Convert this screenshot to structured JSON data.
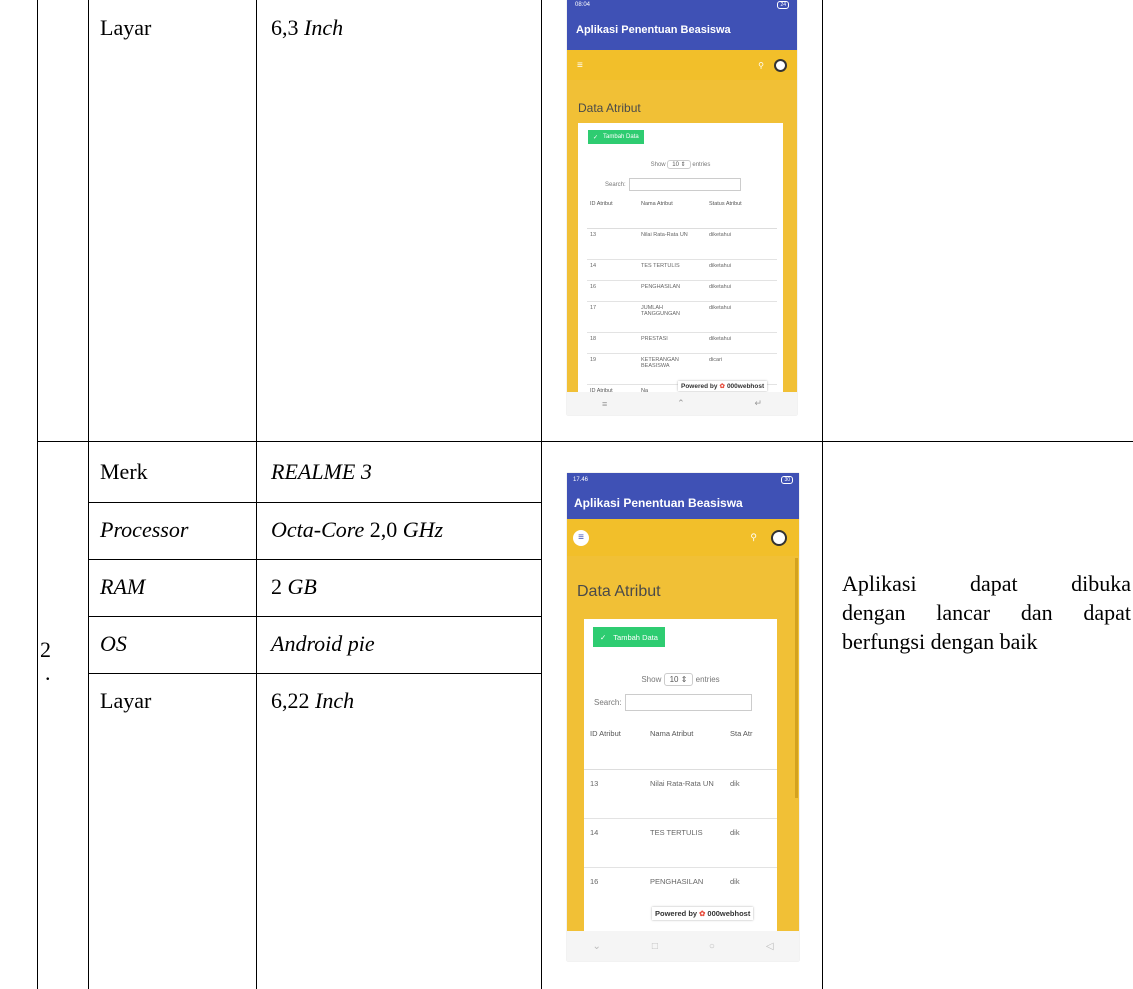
{
  "table": {
    "row1": {
      "layar_label": "Layar",
      "layar_value": "6,3",
      "layar_unit": "Inch"
    },
    "row2": {
      "number": "2",
      "dot": ".",
      "merk_label": "Merk",
      "merk_value": "REALME 3",
      "processor_label": "Processor",
      "processor_value_a": "Octa-Core",
      "processor_value_b": "2,0",
      "processor_value_c": "GHz",
      "ram_label": "RAM",
      "ram_value_a": "2",
      "ram_value_b": "GB",
      "os_label": "OS",
      "os_value": "Android pie",
      "layar_label": "Layar",
      "layar_value": "6,22",
      "layar_unit": "Inch",
      "result_line1": "Aplikasi dapat dibuka",
      "result_line2": "dengan lancar dan dapat",
      "result_line3": "berfungsi dengan baik"
    }
  },
  "phone1": {
    "status_left": "08:04",
    "status_right": "24",
    "app_title": "Aplikasi Penentuan Beasiswa",
    "page_title": "Data Atribut",
    "add_button": "Tambah Data",
    "show": "Show",
    "show_value": "10",
    "entries": "entries",
    "search": "Search:",
    "headers": [
      "ID Atribut",
      "Nama Atribut",
      "Status Atribut"
    ],
    "rows": [
      [
        "13",
        "Nilai Rata-Rata UN",
        "diketahui"
      ],
      [
        "14",
        "TES TERTULIS",
        "diketahui"
      ],
      [
        "16",
        "PENGHASILAN",
        "diketahui"
      ],
      [
        "17",
        "JUMLAH TANGGUNGAN",
        "diketahui"
      ],
      [
        "18",
        "PRESTASI",
        "diketahui"
      ],
      [
        "19",
        "KETERANGAN BEASISWA",
        "dicari"
      ]
    ],
    "footer_id": "ID Atribut",
    "footer_nama": "Na",
    "powered": "Powered by",
    "host": "000webhost"
  },
  "phone2": {
    "status_left": "17.46",
    "status_right": "30",
    "app_title": "Aplikasi Penentuan Beasiswa",
    "page_title": "Data Atribut",
    "add_button": "Tambah Data",
    "show": "Show",
    "show_value": "10",
    "entries": "entries",
    "search": "Search:",
    "headers": [
      "ID Atribut",
      "Nama Atribut",
      "Sta Atr"
    ],
    "rows": [
      [
        "13",
        "Nilai Rata-Rata UN",
        "dik"
      ],
      [
        "14",
        "TES TERTULIS",
        "dik"
      ],
      [
        "16",
        "PENGHASILAN",
        "dik"
      ]
    ],
    "powered": "Powered by",
    "host": "000webhost"
  }
}
